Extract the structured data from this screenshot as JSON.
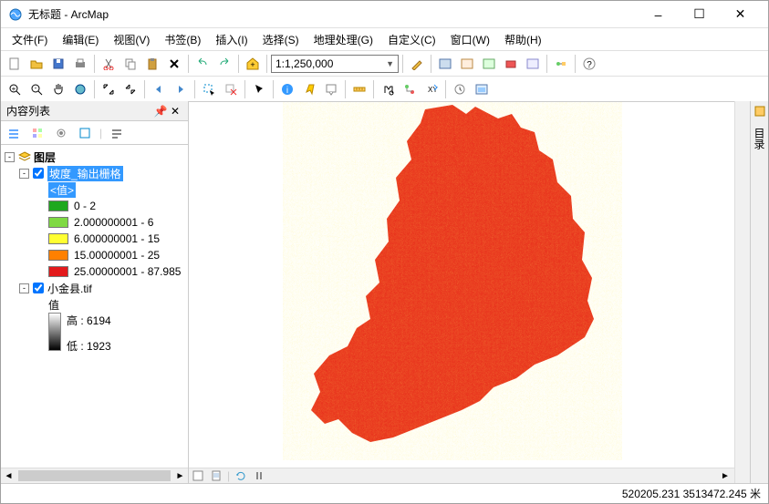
{
  "window": {
    "title": "无标题 - ArcMap",
    "min_label": "–",
    "max_label": "☐",
    "close_label": "✕"
  },
  "menu": {
    "items": [
      "文件(F)",
      "编辑(E)",
      "视图(V)",
      "书签(B)",
      "插入(I)",
      "选择(S)",
      "地理处理(G)",
      "自定义(C)",
      "窗口(W)",
      "帮助(H)"
    ]
  },
  "toolbar1": {
    "scale": "1:1,250,000"
  },
  "toc": {
    "title": "内容列表",
    "root": "图层",
    "layer1": {
      "name": "坡度_输出栅格",
      "value_header": "<值>",
      "classes": [
        {
          "label": "0 - 2",
          "color": "#1fa81f"
        },
        {
          "label": "2.000000001 - 6",
          "color": "#7fd943"
        },
        {
          "label": "6.000000001 - 15",
          "color": "#ffff33"
        },
        {
          "label": "15.00000001 - 25",
          "color": "#ff8000"
        },
        {
          "label": "25.00000001 - 87.985",
          "color": "#e31a1c"
        }
      ]
    },
    "layer2": {
      "name": "小金县.tif",
      "value_header": "值",
      "high_label": "高 : 6194",
      "low_label": "低 : 1923"
    }
  },
  "right_dock": {
    "catalog": "目录"
  },
  "status": {
    "coords": "520205.231  3513472.245 米"
  }
}
